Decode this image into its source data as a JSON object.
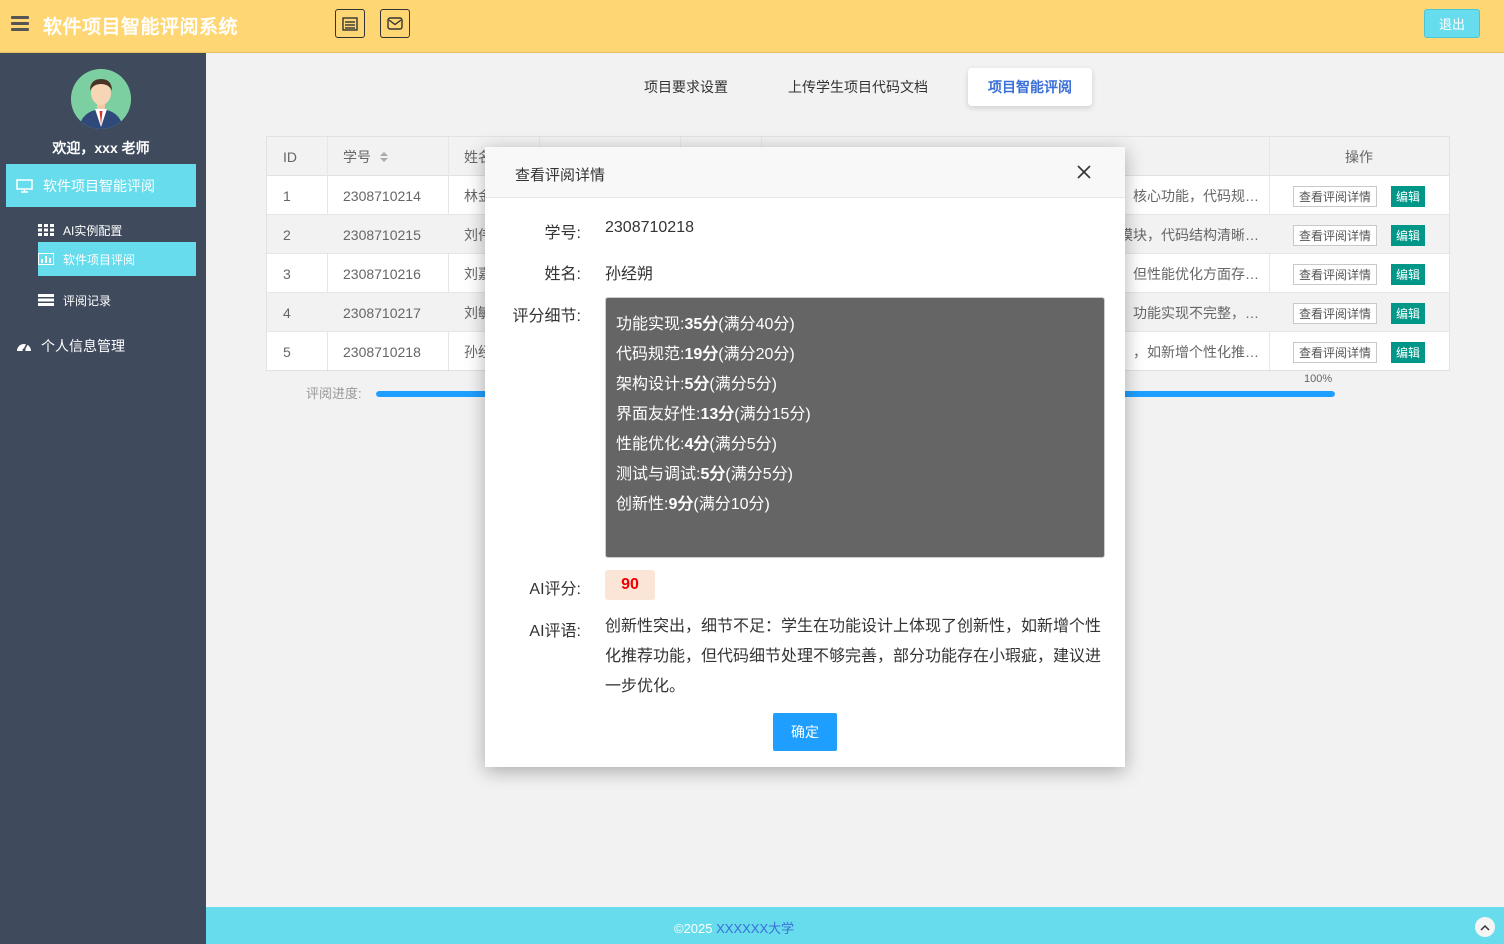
{
  "header": {
    "title": "软件项目智能评阅系统",
    "logout": "退出"
  },
  "sidebar": {
    "welcome": "欢迎，xxx 老师",
    "main_item": "软件项目智能评阅",
    "sub_items": [
      "AI实例配置",
      "软件项目评阅",
      "评阅记录"
    ],
    "personal": "个人信息管理"
  },
  "tabs": [
    "项目要求设置",
    "上传学生项目代码文档",
    "项目智能评阅"
  ],
  "table": {
    "headers": {
      "id": "ID",
      "student_no": "学号",
      "name": "姓名",
      "action": "操作"
    },
    "rows": [
      {
        "id": "1",
        "no": "2308710214",
        "name": "林金",
        "comment": "核心功能，代码规…"
      },
      {
        "id": "2",
        "no": "2308710215",
        "name": "刘伟",
        "comment": "模块，代码结构清晰…"
      },
      {
        "id": "3",
        "no": "2308710216",
        "name": "刘嘉",
        "comment": "但性能优化方面存…"
      },
      {
        "id": "4",
        "no": "2308710217",
        "name": "刘敏",
        "comment": "功能实现不完整，…"
      },
      {
        "id": "5",
        "no": "2308710218",
        "name": "孙经",
        "comment": "，如新增个性化推…"
      }
    ],
    "view_label": "查看评阅详情",
    "edit_label": "编辑"
  },
  "progress": {
    "label": "评阅进度:",
    "percent_text": "100%",
    "value": 1.0
  },
  "footer": {
    "copyright": "©2025 ",
    "org": "XXXXXX大学"
  },
  "modal": {
    "title": "查看评阅详情",
    "labels": {
      "student_no": "学号:",
      "name": "姓名:",
      "details": "评分细节:",
      "ai_score": "AI评分:",
      "ai_comment": "AI评语:"
    },
    "student_no": "2308710218",
    "name": "孙经朔",
    "details": [
      {
        "item": "功能实现:",
        "score": "35分",
        "full": "(满分40分)"
      },
      {
        "item": "代码规范:",
        "score": "19分",
        "full": "(满分20分)"
      },
      {
        "item": "架构设计:",
        "score": "5分",
        "full": "(满分5分)"
      },
      {
        "item": "界面友好性:",
        "score": "13分",
        "full": "(满分15分)"
      },
      {
        "item": "性能优化:",
        "score": "4分",
        "full": "(满分5分)"
      },
      {
        "item": "测试与调试:",
        "score": "5分",
        "full": "(满分5分)"
      },
      {
        "item": "创新性:",
        "score": "9分",
        "full": "(满分10分)"
      }
    ],
    "ai_score": "90",
    "ai_comment": "创新性突出，细节不足：学生在功能设计上体现了创新性，如新增个性化推荐功能，但代码细节处理不够完善，部分功能存在小瑕疵，建议进一步优化。",
    "ok": "确定"
  }
}
